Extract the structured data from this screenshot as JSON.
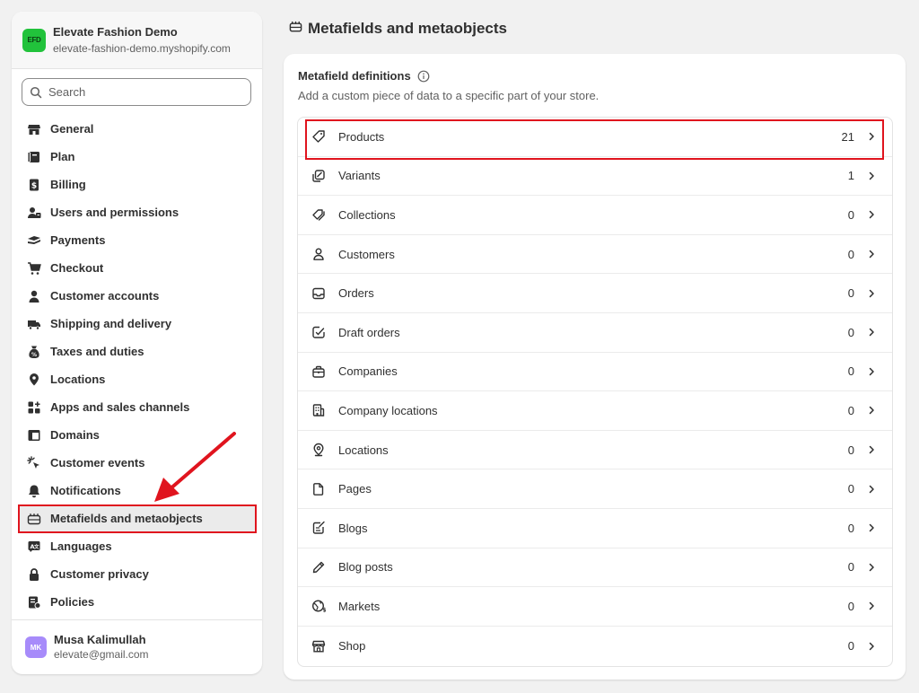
{
  "store": {
    "avatar_initials": "EFD",
    "name": "Elevate Fashion Demo",
    "domain": "elevate-fashion-demo.myshopify.com"
  },
  "search": {
    "placeholder": "Search"
  },
  "sidebar": {
    "items": [
      {
        "label": "General",
        "icon": "store-icon"
      },
      {
        "label": "Plan",
        "icon": "plan-icon"
      },
      {
        "label": "Billing",
        "icon": "billing-icon"
      },
      {
        "label": "Users and permissions",
        "icon": "users-icon"
      },
      {
        "label": "Payments",
        "icon": "payments-icon"
      },
      {
        "label": "Checkout",
        "icon": "cart-icon"
      },
      {
        "label": "Customer accounts",
        "icon": "person-icon"
      },
      {
        "label": "Shipping and delivery",
        "icon": "truck-icon"
      },
      {
        "label": "Taxes and duties",
        "icon": "tax-icon"
      },
      {
        "label": "Locations",
        "icon": "location-icon"
      },
      {
        "label": "Apps and sales channels",
        "icon": "apps-icon"
      },
      {
        "label": "Domains",
        "icon": "domains-icon"
      },
      {
        "label": "Customer events",
        "icon": "cursor-icon"
      },
      {
        "label": "Notifications",
        "icon": "bell-icon"
      },
      {
        "label": "Metafields and metaobjects",
        "icon": "metafields-icon",
        "active": true
      },
      {
        "label": "Languages",
        "icon": "languages-icon"
      },
      {
        "label": "Customer privacy",
        "icon": "lock-icon"
      },
      {
        "label": "Policies",
        "icon": "policies-icon"
      }
    ]
  },
  "user": {
    "initials": "MK",
    "name": "Musa Kalimullah",
    "email": "elevate@gmail.com"
  },
  "page": {
    "title": "Metafields and metaobjects"
  },
  "card": {
    "title": "Metafield definitions",
    "subtitle": "Add a custom piece of data to a specific part of your store.",
    "rows": [
      {
        "label": "Products",
        "count": "21",
        "icon": "tag-icon"
      },
      {
        "label": "Variants",
        "count": "1",
        "icon": "variants-icon"
      },
      {
        "label": "Collections",
        "count": "0",
        "icon": "collections-icon"
      },
      {
        "label": "Customers",
        "count": "0",
        "icon": "person-outline-icon"
      },
      {
        "label": "Orders",
        "count": "0",
        "icon": "inbox-icon"
      },
      {
        "label": "Draft orders",
        "count": "0",
        "icon": "draft-icon"
      },
      {
        "label": "Companies",
        "count": "0",
        "icon": "briefcase-icon"
      },
      {
        "label": "Company locations",
        "count": "0",
        "icon": "building-icon"
      },
      {
        "label": "Locations",
        "count": "0",
        "icon": "pin-icon"
      },
      {
        "label": "Pages",
        "count": "0",
        "icon": "page-icon"
      },
      {
        "label": "Blogs",
        "count": "0",
        "icon": "blog-icon"
      },
      {
        "label": "Blog posts",
        "count": "0",
        "icon": "pencil-icon"
      },
      {
        "label": "Markets",
        "count": "0",
        "icon": "globe-icon"
      },
      {
        "label": "Shop",
        "count": "0",
        "icon": "shop-icon"
      }
    ]
  },
  "colors": {
    "accent_highlight": "#e0141e",
    "store_avatar": "#21c23b",
    "user_avatar": "#a78bfa"
  }
}
